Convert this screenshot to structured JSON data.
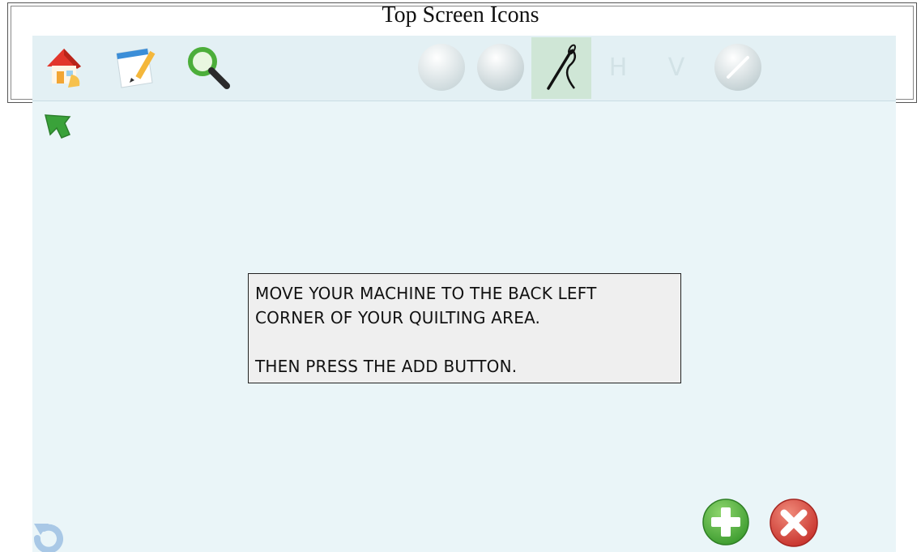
{
  "annotation": {
    "title": "Top Screen Icons"
  },
  "toolbar": {
    "left_icons": [
      "home-icon",
      "notepad-pencil-icon",
      "magnifier-icon"
    ],
    "right_icons": [
      "circle-button-icon",
      "circle-button-icon",
      "needle-thread-icon",
      "H",
      "V",
      "pencil-circle-icon"
    ],
    "h_label": "H",
    "v_label": "V",
    "active_item": "needle-thread-icon"
  },
  "dialog": {
    "line1": "MOVE YOUR MACHINE TO THE BACK LEFT",
    "line2": "CORNER OF YOUR QUILTING AREA.",
    "line3": "THEN PRESS THE ADD BUTTON."
  },
  "buttons": {
    "add": "plus-icon",
    "cancel": "x-icon",
    "undo": "undo-icon",
    "nav": "arrow-up-left-icon"
  },
  "colors": {
    "screen_bg": "#eaf5f8",
    "add_green": "#4cae3a",
    "cancel_red": "#d9413a",
    "nav_green": "#3a9a3a"
  }
}
